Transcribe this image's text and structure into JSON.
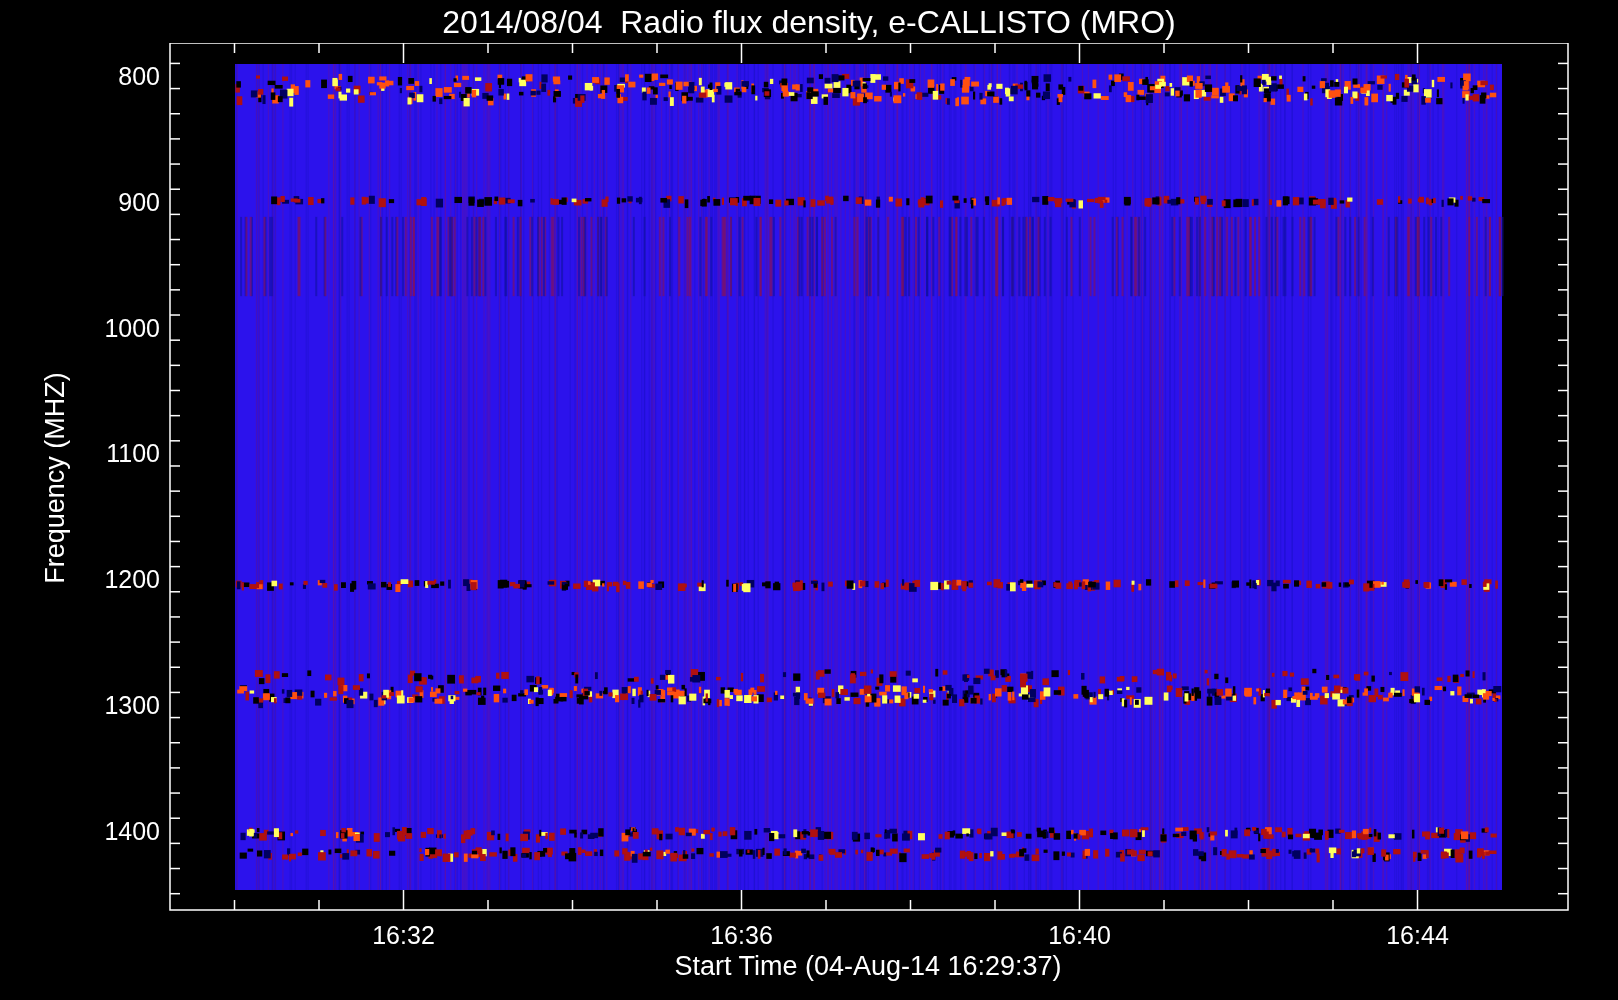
{
  "plot": {
    "title": "2014/08/04  Radio flux density, e-CALLISTO (MRO)",
    "xlabel": "Start Time (04-Aug-14 16:29:37)",
    "ylabel": "Frequency (MHZ)",
    "xticks": [
      "16:32",
      "16:36",
      "16:40",
      "16:44"
    ],
    "yticks": [
      "800",
      "900",
      "1000",
      "1100",
      "1200",
      "1300",
      "1400"
    ]
  }
}
